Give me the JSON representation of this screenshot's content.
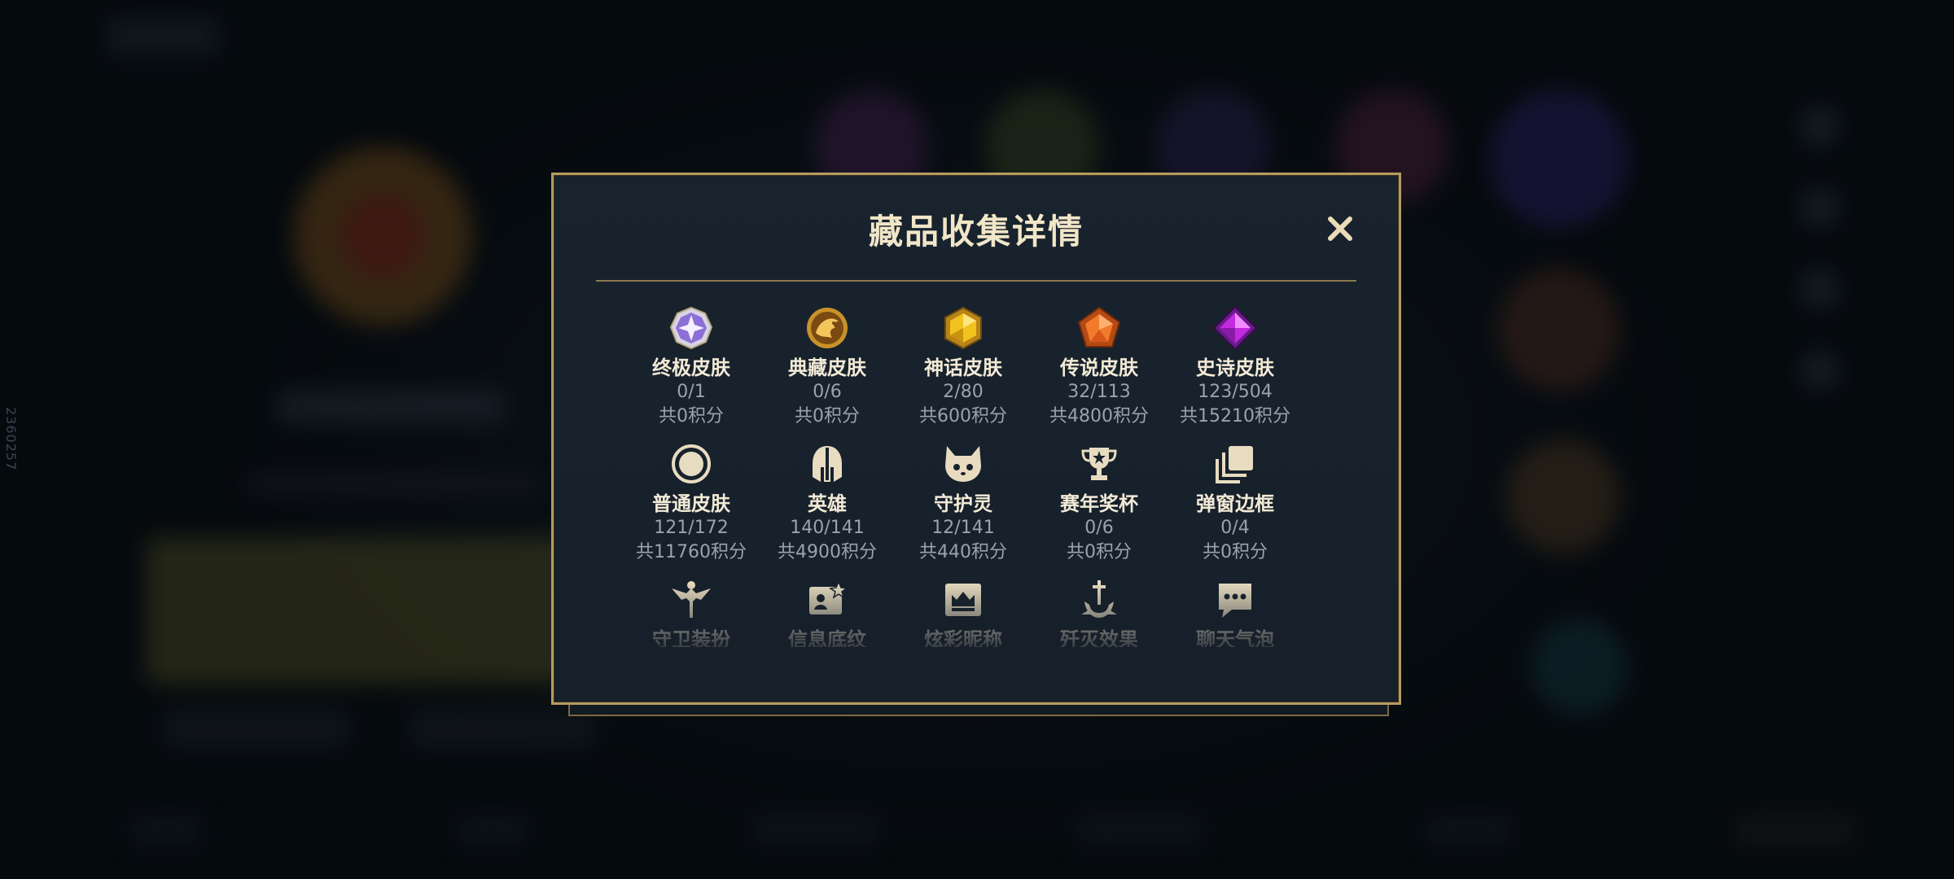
{
  "side_id": "2360257",
  "modal": {
    "title": "藏品收集详情",
    "close_label": "×"
  },
  "colors": {
    "gold": "#b59b5f",
    "title": "#f1e6c8",
    "muted": "#9aa3ac",
    "modal_bg": "#18222d"
  },
  "items": [
    {
      "name": "终极皮肤",
      "count": "0/1",
      "points": "共0积分",
      "icon": "ultimate-skin-gem-icon"
    },
    {
      "name": "典藏皮肤",
      "count": "0/6",
      "points": "共0积分",
      "icon": "prestige-skin-dragon-icon"
    },
    {
      "name": "神话皮肤",
      "count": "2/80",
      "points": "共600积分",
      "icon": "mythic-skin-gem-icon"
    },
    {
      "name": "传说皮肤",
      "count": "32/113",
      "points": "共4800积分",
      "icon": "legendary-skin-gem-icon"
    },
    {
      "name": "史诗皮肤",
      "count": "123/504",
      "points": "共15210积分",
      "icon": "epic-skin-gem-icon"
    },
    {
      "name": "普通皮肤",
      "count": "121/172",
      "points": "共11760积分",
      "icon": "normal-skin-ring-icon"
    },
    {
      "name": "英雄",
      "count": "140/141",
      "points": "共4900积分",
      "icon": "champion-helmet-icon"
    },
    {
      "name": "守护灵",
      "count": "12/141",
      "points": "共440积分",
      "icon": "guardian-spirit-icon"
    },
    {
      "name": "赛年奖杯",
      "count": "0/6",
      "points": "共0积分",
      "icon": "season-trophy-icon"
    },
    {
      "name": "弹窗边框",
      "count": "0/4",
      "points": "共0积分",
      "icon": "popup-frame-icon"
    },
    {
      "name": "守卫装扮",
      "icon": "ward-skin-icon"
    },
    {
      "name": "信息底纹",
      "icon": "info-card-background-icon"
    },
    {
      "name": "炫彩昵称",
      "icon": "colorful-nickname-icon"
    },
    {
      "name": "歼灭效果",
      "icon": "kill-effect-icon"
    },
    {
      "name": "聊天气泡",
      "icon": "chat-bubble-icon"
    }
  ]
}
